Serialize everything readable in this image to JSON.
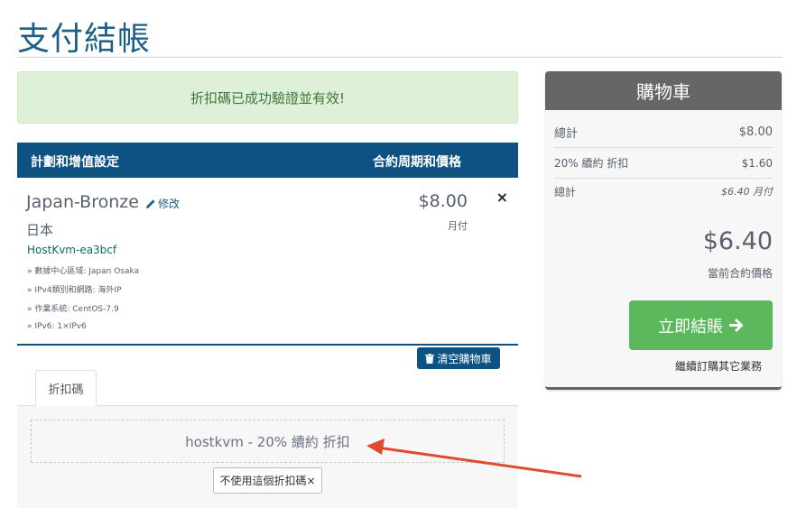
{
  "page": {
    "title": "支付結帳"
  },
  "alert": {
    "message": "折扣碼已成功驗證並有效!"
  },
  "cart_table": {
    "col_plan": "計劃和增值設定",
    "col_cycle": "合約周期和價格",
    "item": {
      "product_name": "Japan-Bronze",
      "edit_label": "修改",
      "group": "日本",
      "hostname": "HostKvm-ea3bcf",
      "config": [
        "» 數據中心區域: Japan Osaka",
        "» IPv4類別和網路: 海外IP",
        "» 作業系統: CentOS-7.9",
        "» IPv6: 1×IPv6"
      ],
      "price": "$8.00",
      "cycle": "月付",
      "remove_symbol": "×"
    },
    "empty_cart_label": "清空購物車"
  },
  "promo": {
    "tab_label": "折扣碼",
    "applied_code": "hostkvm - 20% 續約 折扣",
    "remove_label": "不使用這個折扣碼×"
  },
  "summary": {
    "title": "購物車",
    "subtotal_label": "總計",
    "subtotal_value": "$8.00",
    "discount_label": "20% 續約 折扣",
    "discount_value": "$1.60",
    "recurring_label": "總計",
    "recurring_value": "$6.40 月付",
    "total_due": "$6.40",
    "total_due_label": "當前合約價格",
    "checkout_label": "立即結賬",
    "continue_label": "繼續訂購其它業務"
  },
  "colors": {
    "brand_blue": "#0e5283",
    "success_bg": "#dff0d8",
    "checkout_green": "#5cb85c",
    "annotation_arrow": "#e04a2f"
  }
}
